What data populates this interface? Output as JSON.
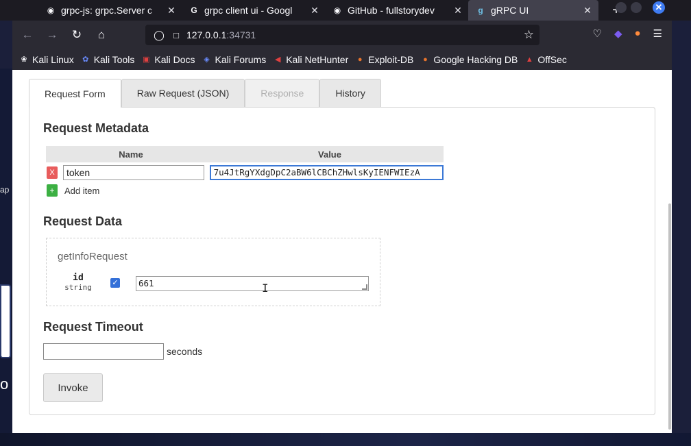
{
  "browser": {
    "tabs": [
      {
        "label": "grpc-js: grpc.Server c",
        "icon": "github-icon"
      },
      {
        "label": "grpc client ui - Googl",
        "icon": "google-icon"
      },
      {
        "label": "GitHub - fullstorydev",
        "icon": "github-icon"
      },
      {
        "label": "gRPC UI",
        "icon": "grpc-icon",
        "active": true
      }
    ],
    "url_host": "127.0.0.1",
    "url_port": ":34731",
    "bookmarks": [
      {
        "label": "Kali Linux",
        "icon": "kali-icon"
      },
      {
        "label": "Kali Tools",
        "icon": "kali-tools-icon"
      },
      {
        "label": "Kali Docs",
        "icon": "kali-docs-icon"
      },
      {
        "label": "Kali Forums",
        "icon": "kali-forums-icon"
      },
      {
        "label": "Kali NetHunter",
        "icon": "nethunter-icon"
      },
      {
        "label": "Exploit-DB",
        "icon": "exploitdb-icon"
      },
      {
        "label": "Google Hacking DB",
        "icon": "ghdb-icon"
      },
      {
        "label": "OffSec",
        "icon": "offsec-icon"
      }
    ]
  },
  "desktop": {
    "fragment_top": "ap",
    "fragment_bottom": "o"
  },
  "page": {
    "tabs": [
      "Request Form",
      "Raw Request (JSON)",
      "Response",
      "History"
    ],
    "metadata_heading": "Request Metadata",
    "metadata_columns": [
      "Name",
      "Value"
    ],
    "metadata_rows": [
      {
        "remove": "X",
        "name": "token",
        "value": "7u4JtRgYXdgDpC2aBW6lCBChZHwlsKyIENFWIEzA"
      }
    ],
    "add_item_symbol": "+",
    "add_item_label": "Add item",
    "data_heading": "Request Data",
    "message_name": "getInfoRequest",
    "field": {
      "name": "id",
      "type": "string",
      "checked": true,
      "value": "661"
    },
    "timeout_heading": "Request Timeout",
    "timeout_value": "",
    "timeout_unit": "seconds",
    "invoke_label": "Invoke"
  }
}
